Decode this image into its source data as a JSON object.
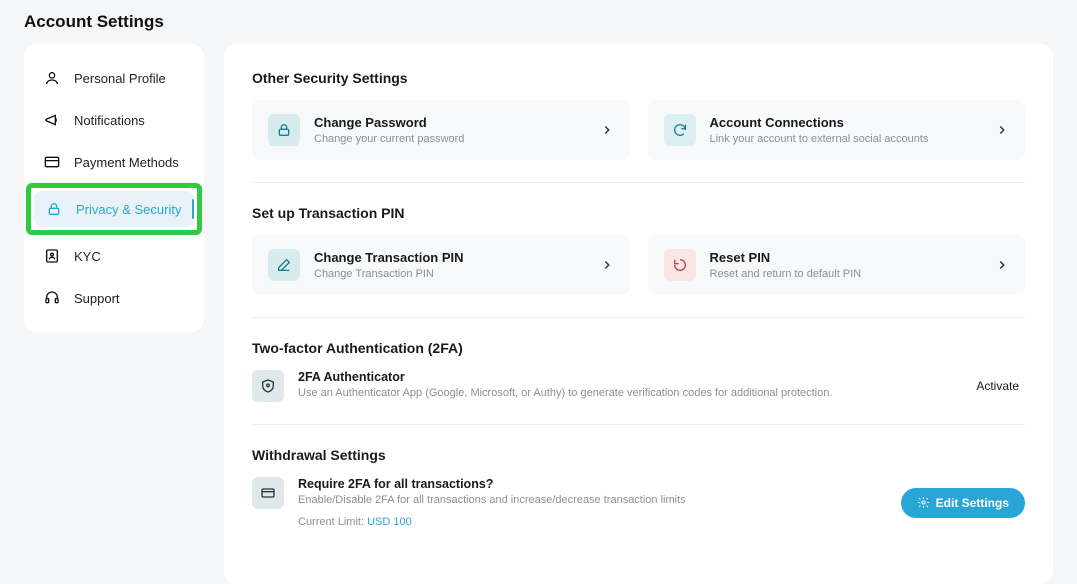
{
  "page_title": "Account Settings",
  "sidebar": {
    "items": [
      {
        "label": "Personal Profile",
        "icon": "user"
      },
      {
        "label": "Notifications",
        "icon": "megaphone"
      },
      {
        "label": "Payment Methods",
        "icon": "card"
      },
      {
        "label": "Privacy & Security",
        "icon": "lock",
        "active": true
      },
      {
        "label": "KYC",
        "icon": "id-badge"
      },
      {
        "label": "Support",
        "icon": "headset"
      }
    ]
  },
  "sections": {
    "other_security": {
      "heading": "Other Security Settings",
      "change_password": {
        "title": "Change Password",
        "sub": "Change your current password"
      },
      "account_connections": {
        "title": "Account Connections",
        "sub": "Link your account to external social accounts"
      }
    },
    "transaction_pin": {
      "heading": "Set up Transaction PIN",
      "change_pin": {
        "title": "Change Transaction PIN",
        "sub": "Change Transaction PIN"
      },
      "reset_pin": {
        "title": "Reset PIN",
        "sub": "Reset and return to default PIN"
      }
    },
    "twofa": {
      "heading": "Two-factor Authentication (2FA)",
      "authenticator": {
        "title": "2FA Authenticator",
        "sub": "Use an Authenticator App (Google, Microsoft, or Authy) to generate verification codes for additional protection.",
        "action": "Activate"
      }
    },
    "withdrawal": {
      "heading": "Withdrawal Settings",
      "require_2fa": {
        "title": "Require 2FA for all transactions?",
        "sub": "Enable/Disable 2FA for all transactions and increase/decrease transaction limits",
        "limit_label": "Current Limit: ",
        "limit_value": "USD 100",
        "action": "Edit Settings"
      }
    }
  }
}
